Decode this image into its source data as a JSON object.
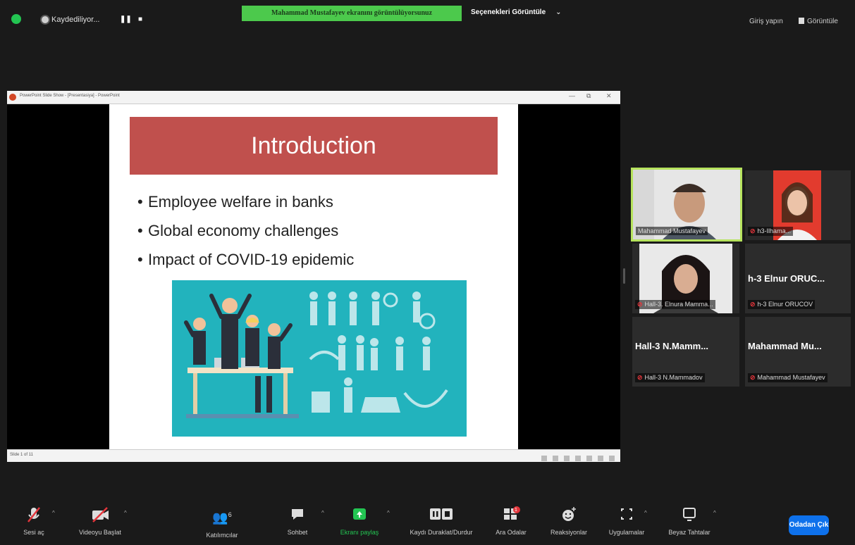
{
  "topbar": {
    "recording_label": "Kaydediliyor...",
    "pause_glyph": "❚❚",
    "stop_glyph": "■",
    "share_banner": "Mahammad Mustafayev ekranını görüntülüyorsunuz",
    "view_options": "Seçenekleri Görüntüle",
    "view_options_chevron": "⌄",
    "sign_in": "Giriş yapın",
    "view_label": "Görüntüle"
  },
  "ppt_window": {
    "title": "PowerPoint Slide Show - [Presentasiya] - PowerPoint",
    "minimize": "—",
    "restore": "⧉",
    "close": "✕",
    "slide_counter": "Slide 1 of 11"
  },
  "slide": {
    "title": "Introduction",
    "bullets": [
      "Employee welfare in banks",
      "Global economy challenges",
      "Impact of COVID-19 epidemic"
    ],
    "bullet_glyph": "•",
    "title_bg": "#c0504d",
    "illustration_bg": "#22b3bd"
  },
  "gallery": [
    {
      "name": "",
      "label": "Mahammad Mustafayev",
      "has_video": true,
      "active": true,
      "muted": false
    },
    {
      "name": "",
      "label": "h3-Ilhama...",
      "has_video": true,
      "active": false,
      "muted": true
    },
    {
      "name": "",
      "label": "Hall-3. Elnura Mamma...",
      "has_video": true,
      "active": false,
      "muted": true
    },
    {
      "name": "h-3 Elnur ORUC...",
      "label": "h-3 Elnur ORUCOV",
      "has_video": false,
      "active": false,
      "muted": true
    },
    {
      "name": "Hall-3 N.Mamm...",
      "label": "Hall-3 N.Mammadov",
      "has_video": false,
      "active": false,
      "muted": true
    },
    {
      "name": "Mahammad Mu...",
      "label": "Mahammad Mustafayev",
      "has_video": false,
      "active": false,
      "muted": true
    }
  ],
  "toolbar": {
    "unmute": "Sesi aç",
    "start_video": "Videoyu Başlat",
    "participants": "Katılımcılar",
    "participants_count": "6",
    "chat": "Sohbet",
    "share_screen": "Ekranı paylaş",
    "record_pause_stop": "Kaydı Duraklat/Durdur",
    "breakout_rooms": "Ara Odalar",
    "breakout_badge": "1",
    "reactions": "Reaksiyonlar",
    "apps": "Uygulamalar",
    "whiteboards": "Beyaz Tahtalar",
    "leave": "Odadan Çık",
    "caret": "^"
  },
  "icons": {
    "security": "shield-icon",
    "recording": "record-dot-icon",
    "mic": "mic-muted-icon",
    "video": "video-off-icon",
    "participants": "people-icon",
    "chat": "chat-bubble-icon",
    "share": "share-screen-icon",
    "record": "pause-stop-icon",
    "breakout": "breakout-rooms-icon",
    "reactions": "smile-plus-icon",
    "apps": "apps-icon",
    "whiteboard": "whiteboard-icon"
  },
  "colors": {
    "share_banner": "#4cc94c",
    "active_speaker": "#b6e35d",
    "leave_button": "#0e71eb",
    "security_shield": "#23c552"
  }
}
